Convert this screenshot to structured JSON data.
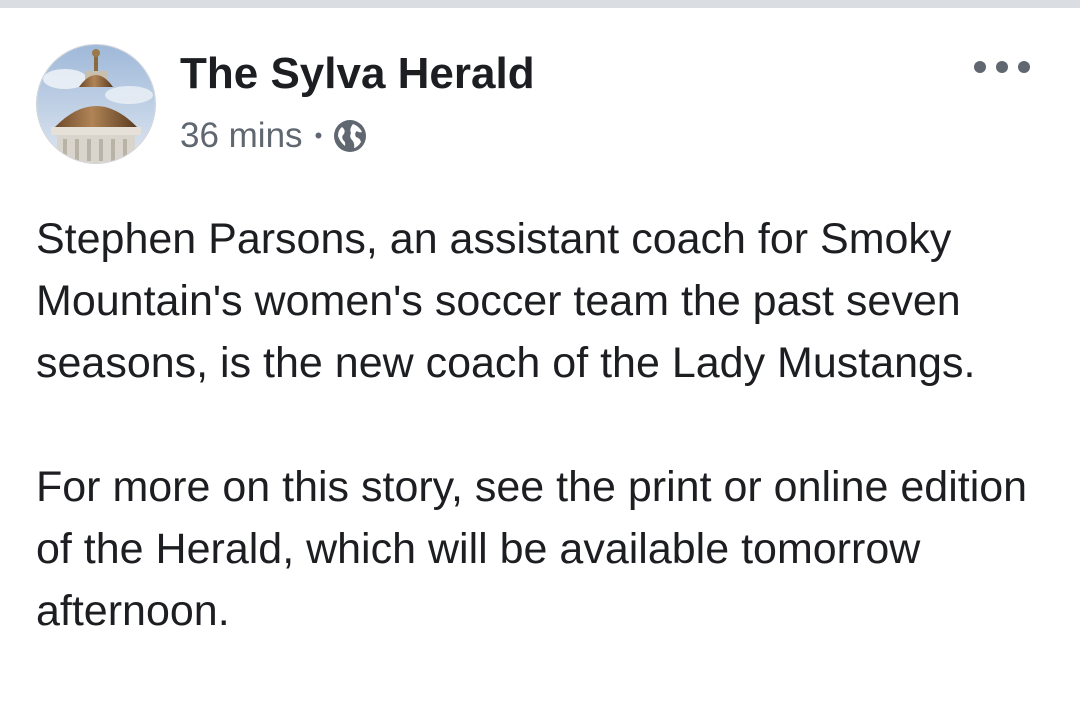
{
  "post": {
    "page_name": "The Sylva Herald",
    "timestamp": "36 mins",
    "separator": "•",
    "privacy_icon": "globe-icon",
    "more_icon": "more-options-icon",
    "avatar_icon": "courthouse-dome-avatar",
    "paragraphs": [
      "Stephen Parsons, an assistant coach for Smoky Mountain's women's soccer team the past seven seasons, is the new coach of the Lady Mustangs.",
      "For more on this story, see the print or online edition of the Herald, which will be available tomorrow afternoon."
    ]
  },
  "colors": {
    "text": "#1c1e21",
    "secondary": "#606770",
    "divider": "#dadde1",
    "background": "#ffffff"
  }
}
